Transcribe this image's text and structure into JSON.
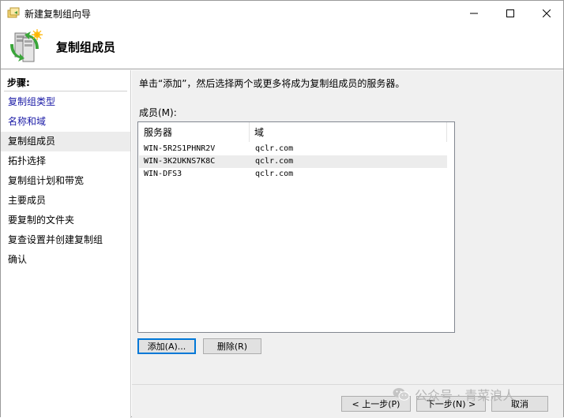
{
  "window": {
    "title": "新建复制组向导",
    "controls": {
      "minimize": "minimize-icon",
      "maximize": "maximize-icon",
      "close": "close-icon"
    }
  },
  "header": {
    "title": "复制组成员",
    "icon": "replication-servers-icon"
  },
  "nav": {
    "title": "步骤:",
    "items": [
      {
        "label": "复制组类型",
        "state": "link"
      },
      {
        "label": "名称和域",
        "state": "link"
      },
      {
        "label": "复制组成员",
        "state": "current"
      },
      {
        "label": "拓扑选择",
        "state": "plain"
      },
      {
        "label": "复制组计划和带宽",
        "state": "plain"
      },
      {
        "label": "主要成员",
        "state": "plain"
      },
      {
        "label": "要复制的文件夹",
        "state": "plain"
      },
      {
        "label": "复查设置并创建复制组",
        "state": "plain"
      },
      {
        "label": "确认",
        "state": "plain"
      }
    ]
  },
  "main": {
    "instruction": "单击“添加”，然后选择两个或更多将成为复制组成员的服务器。",
    "members_label": "成员(M):",
    "columns": [
      "服务器",
      "域"
    ],
    "rows": [
      {
        "server": "WIN-5R2S1PHNR2V",
        "domain": "qclr.com",
        "selected": false
      },
      {
        "server": "WIN-3K2UKNS7K8C",
        "domain": "qclr.com",
        "selected": true
      },
      {
        "server": "WIN-DFS3",
        "domain": "qclr.com",
        "selected": false
      }
    ],
    "add_button": "添加(A)...",
    "remove_button": "删除(R)"
  },
  "footer": {
    "prev_button": "< 上一步(P)",
    "next_button": "下一步(N) >",
    "cancel_button": "取消"
  },
  "watermark": {
    "text": "公众号 · 青菜浪人",
    "icon": "wechat-icon"
  },
  "colors": {
    "link": "#1a1aa6",
    "selection": "#ececec",
    "content_bg": "#f0f0f0",
    "default_button_border": "#0078d7"
  }
}
